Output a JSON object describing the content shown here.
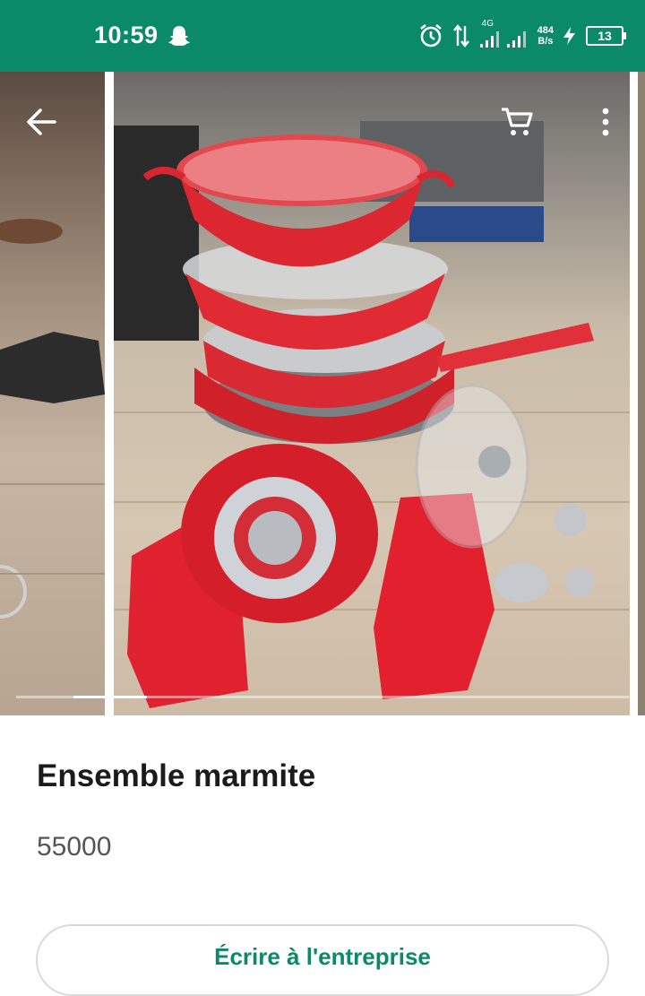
{
  "status_bar": {
    "time": "10:59",
    "network": "4G",
    "speed_value": "484",
    "speed_unit": "B/s",
    "battery": "13"
  },
  "gallery": {
    "images_total": 3,
    "progress": 0.12
  },
  "product": {
    "title": "Ensemble marmite",
    "price": "55000"
  },
  "cta": {
    "label": "Écrire à l'entreprise"
  },
  "colors": {
    "brand": "#0b8a6a",
    "title": "#1b1b1b",
    "price": "#555555"
  },
  "icons": [
    "back-arrow-icon",
    "cart-icon",
    "more-vert-icon",
    "snapchat-ghost-icon",
    "alarm-icon",
    "data-arrows-icon",
    "signal-icon",
    "charging-icon"
  ]
}
